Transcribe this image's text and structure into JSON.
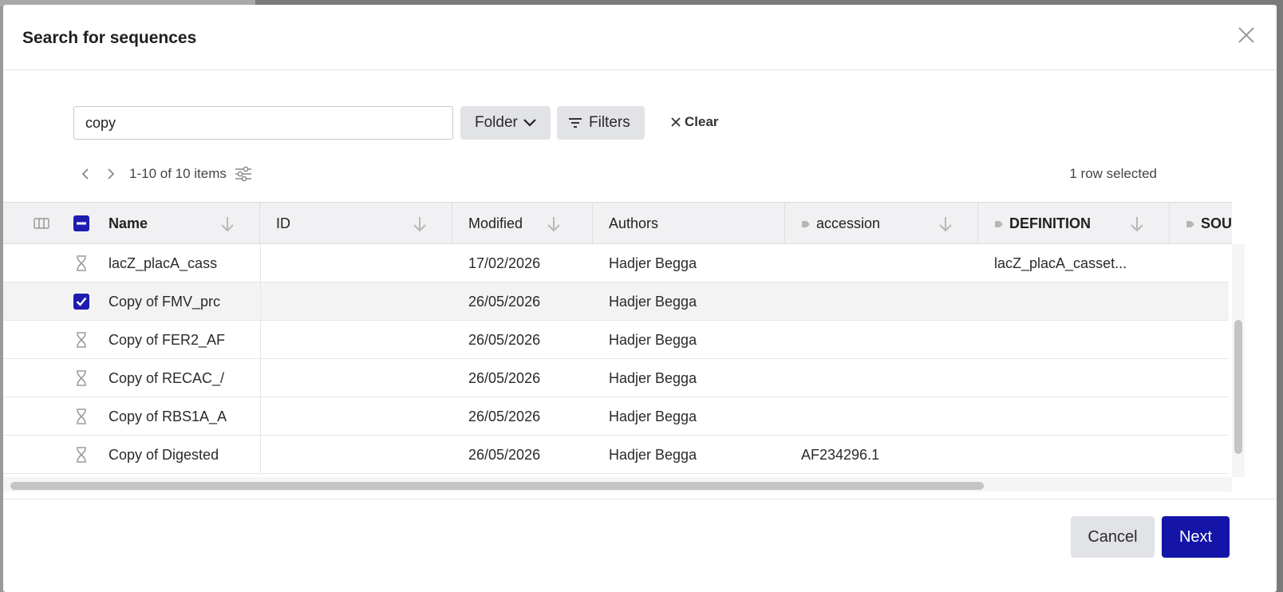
{
  "modal": {
    "title": "Search for sequences"
  },
  "search": {
    "value": "copy"
  },
  "toolbar": {
    "folder_label": "Folder",
    "filters_label": "Filters",
    "clear_label": "Clear"
  },
  "pager": {
    "count": "1-10 of 10 items",
    "selection": "1 row selected"
  },
  "columns": {
    "name": "Name",
    "id": "ID",
    "modified": "Modified",
    "authors": "Authors",
    "accession": "accession",
    "definition": "DEFINITION",
    "source": "SOU"
  },
  "rows": [
    {
      "name": "lacZ_placA_cass",
      "id": "",
      "modified": "17/02/2026",
      "authors": "Hadjer Begga",
      "accession": "",
      "definition": "lacZ_placA_casset...",
      "selected": false
    },
    {
      "name": "Copy of FMV_prc",
      "id": "",
      "modified": "26/05/2026",
      "authors": "Hadjer Begga",
      "accession": "",
      "definition": "",
      "selected": true
    },
    {
      "name": "Copy of FER2_AF",
      "id": "",
      "modified": "26/05/2026",
      "authors": "Hadjer Begga",
      "accession": "",
      "definition": "",
      "selected": false
    },
    {
      "name": "Copy of RECAC_/",
      "id": "",
      "modified": "26/05/2026",
      "authors": "Hadjer Begga",
      "accession": "",
      "definition": "",
      "selected": false
    },
    {
      "name": "Copy of RBS1A_A",
      "id": "",
      "modified": "26/05/2026",
      "authors": "Hadjer Begga",
      "accession": "",
      "definition": "",
      "selected": false
    },
    {
      "name": "Copy of Digested",
      "id": "",
      "modified": "26/05/2026",
      "authors": "Hadjer Begga",
      "accession": "AF234296.1",
      "definition": "",
      "selected": false
    }
  ],
  "footer": {
    "cancel_label": "Cancel",
    "next_label": "Next"
  },
  "colors": {
    "primary": "#1414a8",
    "checkbox": "#1f1bb0",
    "header_bg": "#f1f1f3",
    "button_grey": "#e2e3e6"
  }
}
